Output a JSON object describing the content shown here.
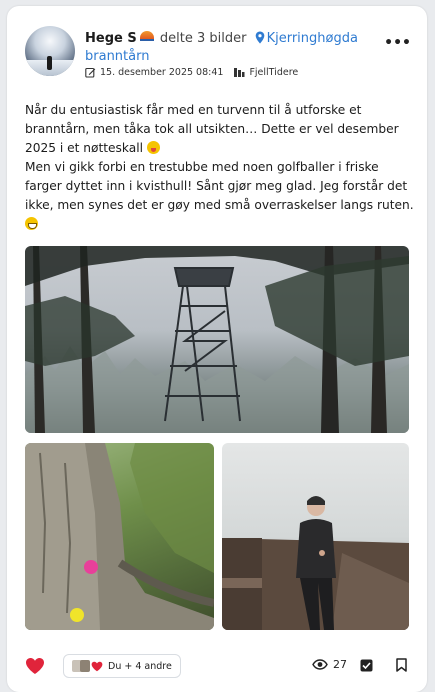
{
  "header": {
    "author": "Hege S",
    "shared_text": "delte 3 bilder",
    "location": "Kjerringhøgda branntårn",
    "timestamp": "15. desember 2025 08:41",
    "group": "FjellTidere"
  },
  "post": {
    "paragraph1": "Når du entusiastisk får med en turvenn til å utforske et branntårn, men tåka tok all utsikten… Dette er vel desember 2025 i et nøtteskall",
    "paragraph2": "Men vi gikk forbi en trestubbe med noen golfballer i friske farger dyttet inn i kvisthull! Sånt gjør meg glad. Jeg forstår det ikke, men synes det er gøy med små overraskelser langs ruten."
  },
  "footer": {
    "reactions_label": "Du + 4 andre",
    "views": "27"
  },
  "icons": {
    "more": "more-horizontal-icon",
    "pin": "location-pin-icon",
    "edit": "edit-icon",
    "group": "group-icon",
    "heart": "heart-icon",
    "eye": "eye-icon",
    "check": "checkbox-icon",
    "bookmark": "bookmark-icon"
  },
  "colors": {
    "link": "#2f7bd1",
    "heart": "#e0243b",
    "text": "#1c1c1c"
  }
}
